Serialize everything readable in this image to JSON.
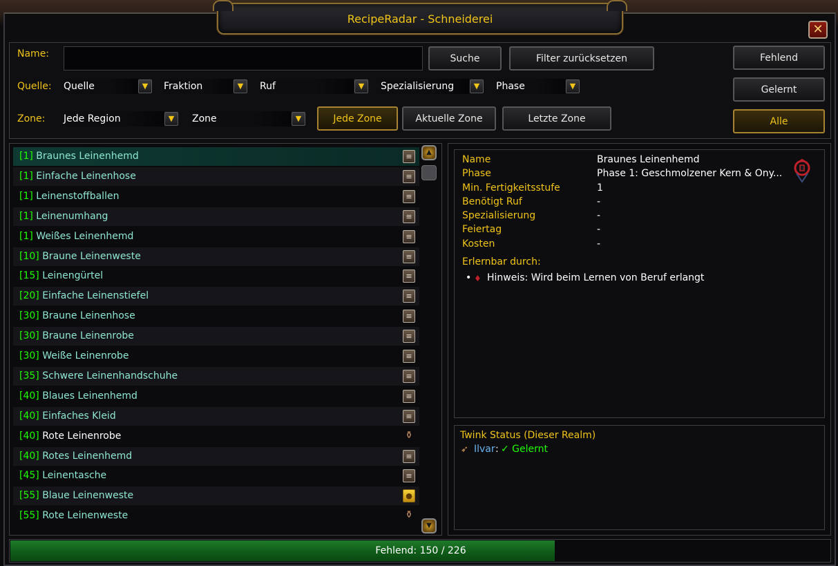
{
  "window": {
    "title": "RecipeRadar - Schneiderei",
    "close_glyph": "✕"
  },
  "filters": {
    "name_label": "Name:",
    "name_value": "",
    "search_button": "Suche",
    "reset_button": "Filter zurücksetzen",
    "source_label": "Quelle:",
    "zone_label": "Zone:",
    "dropdowns": {
      "quelle": "Quelle",
      "fraktion": "Fraktion",
      "ruf": "Ruf",
      "spezialisierung": "Spezialisierung",
      "phase": "Phase",
      "region": "Jede Region",
      "zone": "Zone"
    },
    "zone_buttons": [
      "Jede Zone",
      "Aktuelle Zone",
      "Letzte Zone"
    ],
    "status_buttons": [
      "Fehlend",
      "Gelernt",
      "Alle"
    ]
  },
  "recipes": [
    {
      "level": "[1]",
      "name": "Braunes Leinenhemd",
      "icon": "recipe-scroll-icon"
    },
    {
      "level": "[1]",
      "name": "Einfache Leinenhose",
      "icon": "recipe-scroll-icon"
    },
    {
      "level": "[1]",
      "name": "Leinenstoffballen",
      "icon": "recipe-scroll-icon"
    },
    {
      "level": "[1]",
      "name": "Leinenumhang",
      "icon": "recipe-scroll-icon"
    },
    {
      "level": "[1]",
      "name": "Weißes Leinenhemd",
      "icon": "recipe-scroll-icon"
    },
    {
      "level": "[10]",
      "name": "Braune Leinenweste",
      "icon": "recipe-scroll-icon"
    },
    {
      "level": "[15]",
      "name": "Leinengürtel",
      "icon": "recipe-scroll-icon"
    },
    {
      "level": "[20]",
      "name": "Einfache Leinenstiefel",
      "icon": "recipe-scroll-icon"
    },
    {
      "level": "[30]",
      "name": "Braune Leinenhose",
      "icon": "recipe-scroll-icon"
    },
    {
      "level": "[30]",
      "name": "Braune Leinenrobe",
      "icon": "recipe-scroll-icon"
    },
    {
      "level": "[30]",
      "name": "Weiße Leinenrobe",
      "icon": "recipe-scroll-icon"
    },
    {
      "level": "[35]",
      "name": "Schwere Leinenhandschuhe",
      "icon": "recipe-scroll-icon"
    },
    {
      "level": "[40]",
      "name": "Blaues Leinenhemd",
      "icon": "recipe-scroll-icon"
    },
    {
      "level": "[40]",
      "name": "Einfaches Kleid",
      "icon": "recipe-scroll-icon"
    },
    {
      "level": "[40]",
      "name": "Rote Leinenrobe",
      "icon": "vendor-bag-icon"
    },
    {
      "level": "[40]",
      "name": "Rotes Leinenhemd",
      "icon": "recipe-scroll-icon"
    },
    {
      "level": "[45]",
      "name": "Leinentasche",
      "icon": "recipe-scroll-icon"
    },
    {
      "level": "[55]",
      "name": "Blaue Leinenweste",
      "icon": "gold-coin-icon"
    },
    {
      "level": "[55]",
      "name": "Rote Leinenweste",
      "icon": "vendor-bag-icon"
    }
  ],
  "details": {
    "rows": [
      {
        "key": "Name",
        "value": "Braunes Leinenhemd"
      },
      {
        "key": "Phase",
        "value": "Phase 1: Geschmolzener Kern & Ony..."
      },
      {
        "key": "Min. Fertigkeitsstufe",
        "value": "1"
      },
      {
        "key": "Benötigt Ruf",
        "value": "-"
      },
      {
        "key": "Spezialisierung",
        "value": "-"
      },
      {
        "key": "Feiertag",
        "value": "-"
      },
      {
        "key": "Kosten",
        "value": "-"
      }
    ],
    "learnable_label": "Erlernbar durch:",
    "learnable_items": [
      "Hinweis: Wird beim Lernen von Beruf erlangt"
    ]
  },
  "twink": {
    "title": "Twink Status (Dieser Realm)",
    "char_name": "Ilvar",
    "separator": ":",
    "status": "✓ Gelernt"
  },
  "status_bar": {
    "text": "Fehlend: 150 / 226",
    "missing": 150,
    "total": 226
  },
  "colors": {
    "gold": "#f0c419",
    "level_green": "#1eff00",
    "recipe_teal": "#8ee6d2",
    "progress_green": "#1f7a2a"
  }
}
